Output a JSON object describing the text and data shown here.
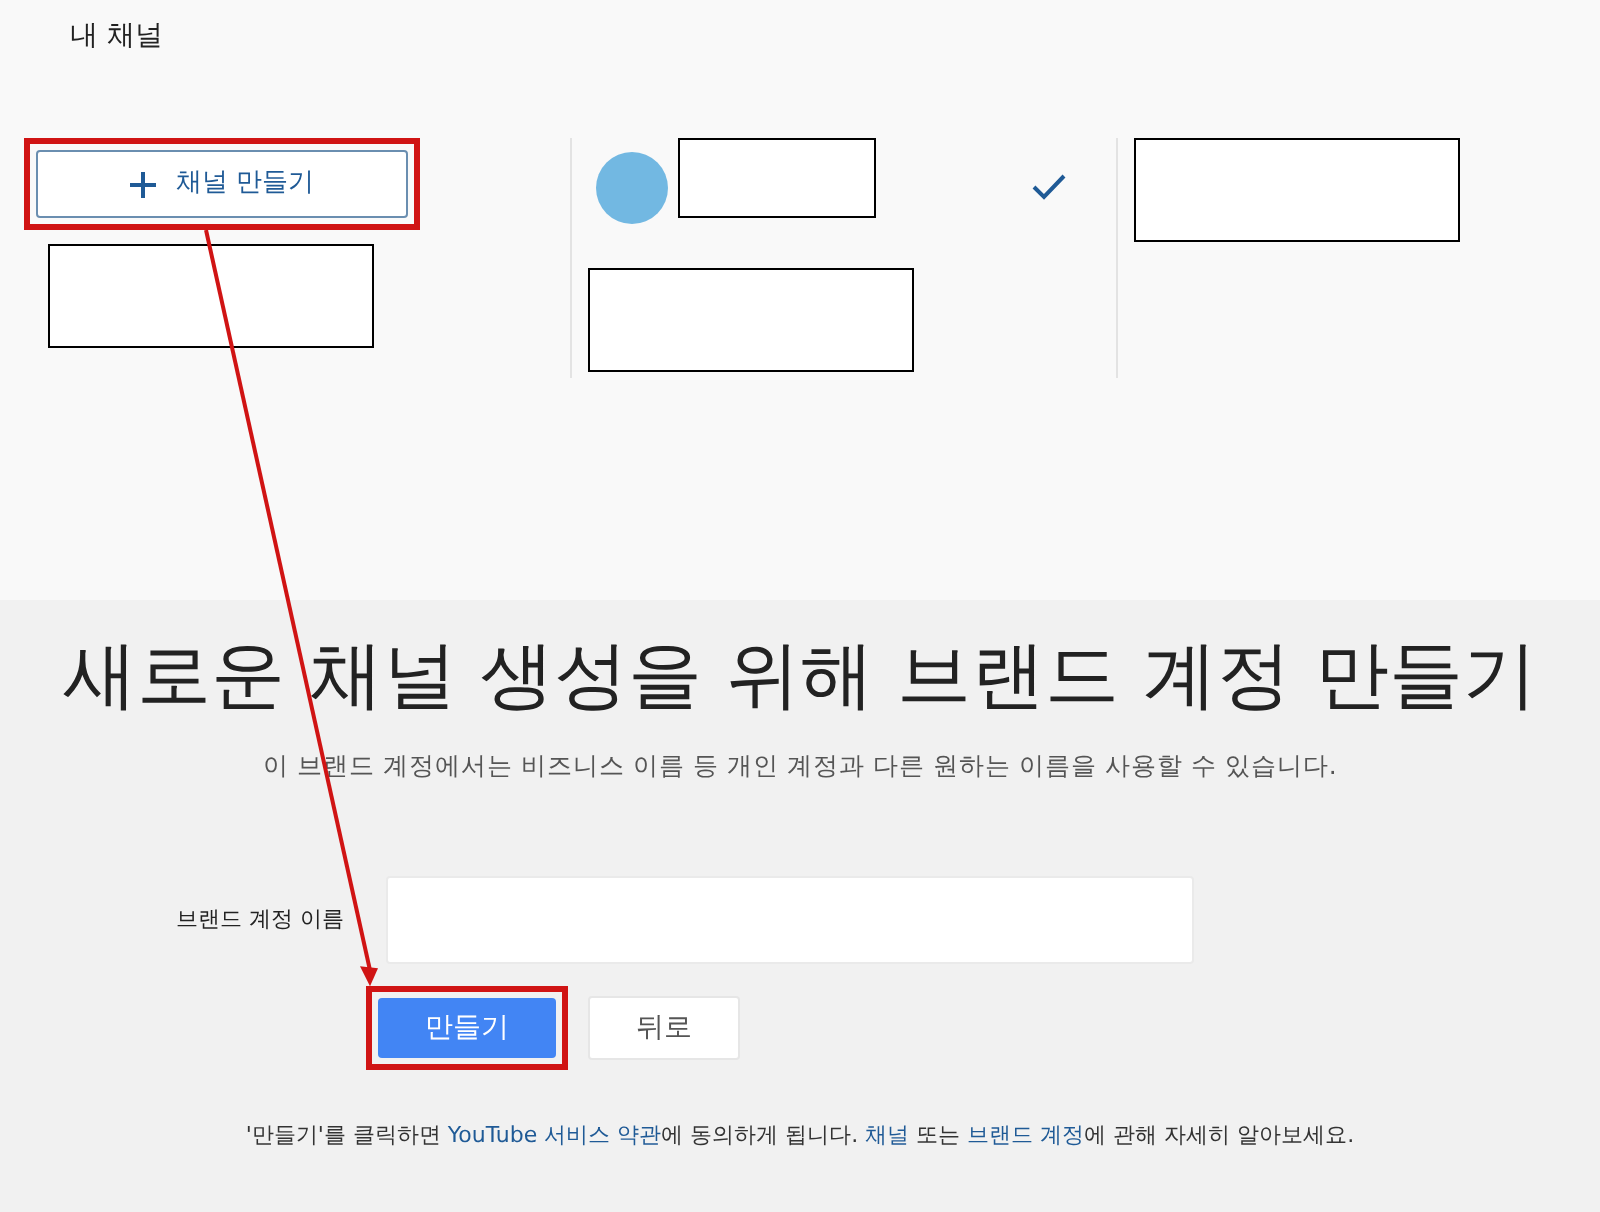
{
  "my_channels": {
    "title": "내 채널",
    "create_button": {
      "label": "채널 만들기",
      "highlighted": true
    },
    "channels": [
      {
        "kind": "current",
        "selected": true
      },
      {
        "kind": "other",
        "selected": false
      }
    ]
  },
  "brand_account": {
    "title": "새로운 채널 생성을 위해 브랜드 계정 만들기",
    "subtitle": "이 브랜드 계정에서는 비즈니스 이름 등 개인 계정과 다른 원하는 이름을 사용할 수 있습니다.",
    "name_field": {
      "label": "브랜드 계정 이름"
    },
    "buttons": [
      {
        "label": "만들기",
        "kind": "primary",
        "highlighted": true
      },
      {
        "label": "뒤로",
        "kind": "secondary",
        "highlighted": false
      }
    ],
    "footer": [
      {
        "text": "'만들기'를 클릭하면 ",
        "link": false
      },
      {
        "text": "YouTube 서비스 약관",
        "link": true
      },
      {
        "text": "에 동의하게 됩니다. ",
        "link": false
      },
      {
        "text": "채널",
        "link": true
      },
      {
        "text": " 또는 ",
        "link": false
      },
      {
        "text": "브랜드 계정",
        "link": true
      },
      {
        "text": "에 관해 자세히 알아보세요.",
        "link": false
      }
    ]
  },
  "annotation": {
    "arrow": true
  }
}
